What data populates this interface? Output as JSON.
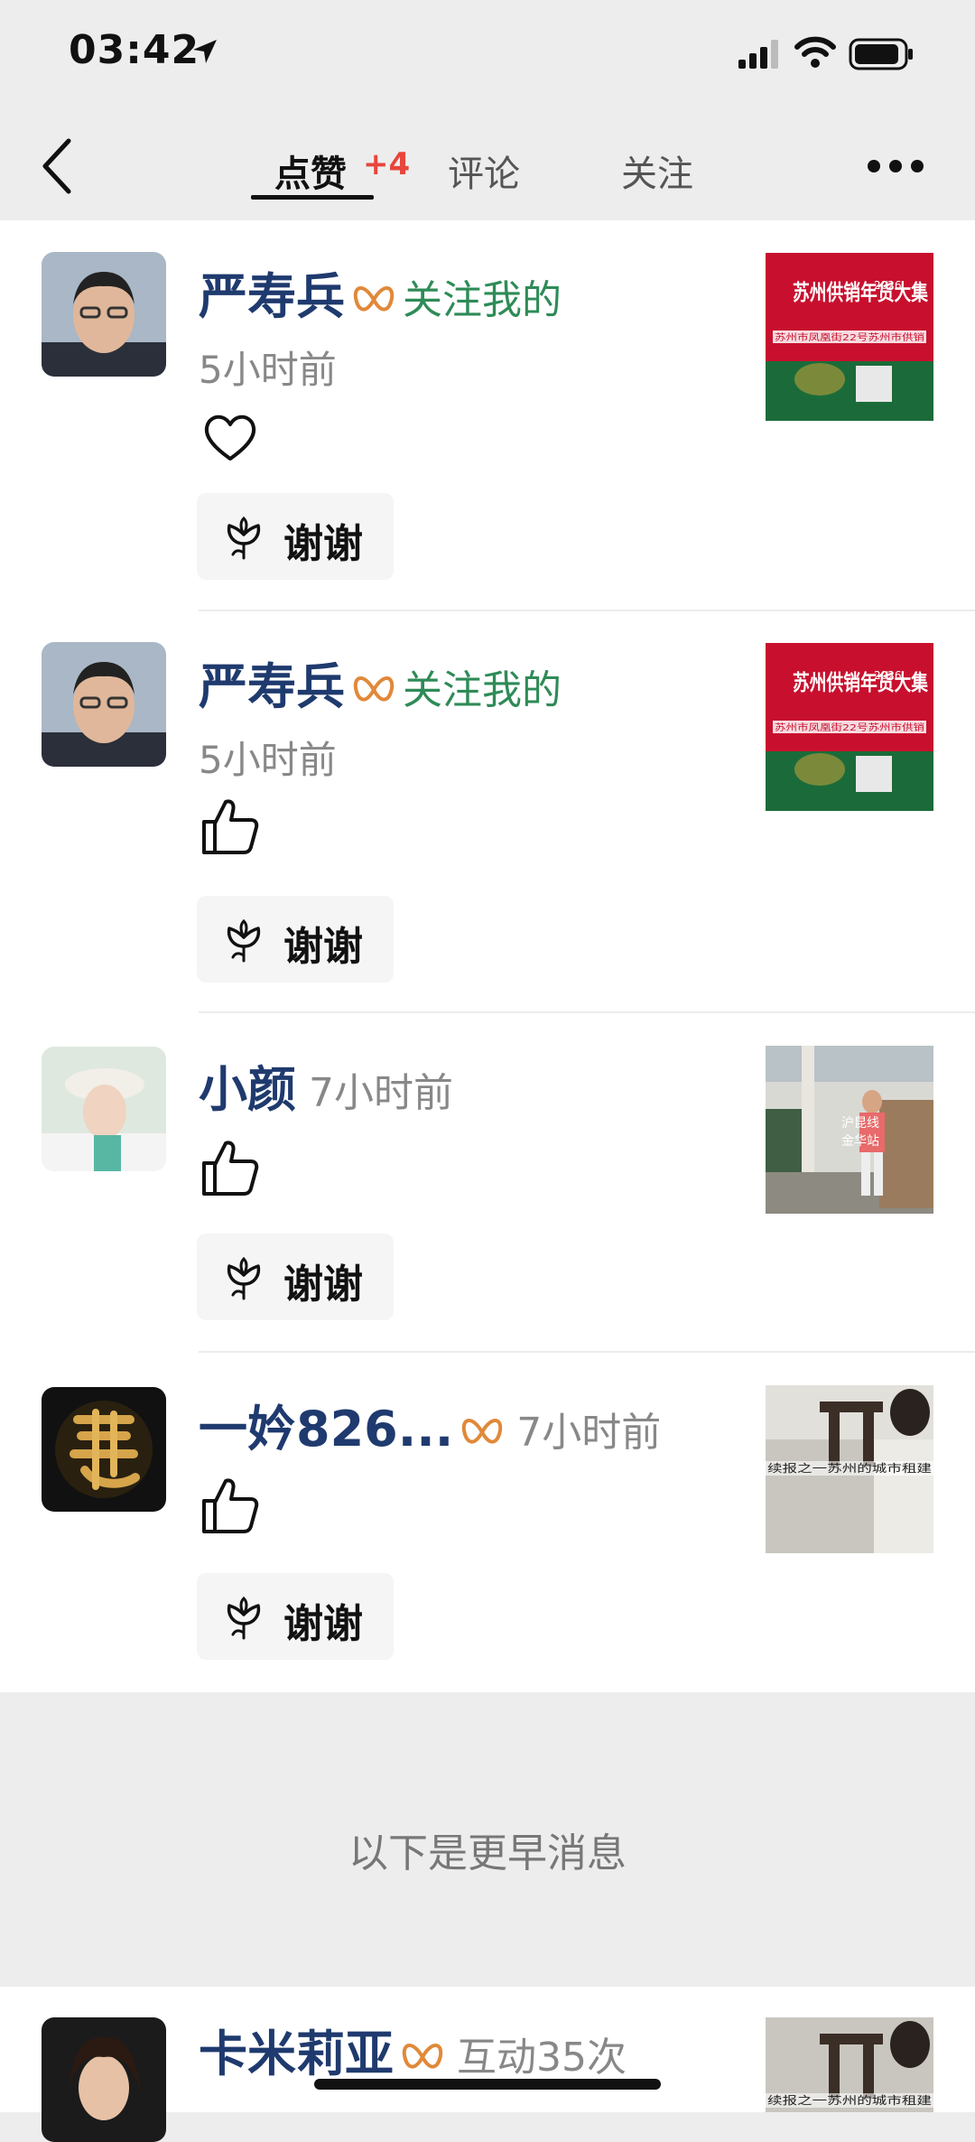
{
  "status_bar": {
    "time": "03:42"
  },
  "nav": {
    "tabs": [
      {
        "label": "点赞",
        "badge": "+4",
        "active": true
      },
      {
        "label": "评论"
      },
      {
        "label": "关注"
      }
    ]
  },
  "items": [
    {
      "name": "严寿兵",
      "follow_text": "关注我的",
      "time": "5小时前",
      "reaction": "heart",
      "thanks_label": "谢谢",
      "thumb_title": "苏州供销年货大集",
      "thumb_year": "2026",
      "thumb_sub": "苏州市凤凰街22号苏州市供销"
    },
    {
      "name": "严寿兵",
      "follow_text": "关注我的",
      "time": "5小时前",
      "reaction": "thumb",
      "thanks_label": "谢谢",
      "thumb_title": "苏州供销年货大集",
      "thumb_year": "2026",
      "thumb_sub": "苏州市凤凰街22号苏州市供销"
    },
    {
      "name": "小颜",
      "time": "7小时前",
      "reaction": "thumb",
      "thanks_label": "谢谢",
      "thumb_caption_1": "沪昆线",
      "thumb_caption_2": "金华站"
    },
    {
      "name": "一妗826...",
      "time": "7小时前",
      "reaction": "thumb",
      "thanks_label": "谢谢",
      "thumb_caption": "续报之一苏州的城市租建"
    }
  ],
  "earlier_label": "以下是更早消息",
  "bottom_item": {
    "name": "卡米莉亚",
    "interaction": "互动35次",
    "thumb_caption": "续报之一苏州的城市租建"
  },
  "colors": {
    "name_blue": "#1f3a6e",
    "follow_green": "#2e8b57",
    "badge_red": "#e8453c",
    "mark_orange": "#e0893a"
  }
}
